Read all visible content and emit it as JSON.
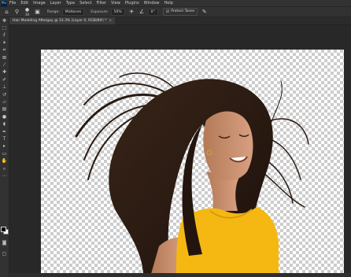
{
  "menubar": {
    "logo": "Ps",
    "items": [
      "File",
      "Edit",
      "Image",
      "Layer",
      "Type",
      "Select",
      "Filter",
      "View",
      "Plugins",
      "Window",
      "Help"
    ]
  },
  "options": {
    "home_icon": "home-icon",
    "brush_size": "30",
    "range_label": "Range:",
    "range_value": "Midtones",
    "exposure_label": "Exposure:",
    "exposure_value": "50%",
    "airbrush_value": "0°",
    "protect_tones_label": "Protect Tones"
  },
  "document": {
    "tab_title": "Hair Modeling Aftergay @ 33.3% (Layer 0, RGB/8#) *",
    "close": "×"
  },
  "tools": [
    "move",
    "marquee",
    "lasso",
    "magic-wand",
    "crop",
    "frame",
    "eyedropper",
    "healing",
    "brush",
    "clone-stamp",
    "history-brush",
    "eraser",
    "gradient",
    "blur",
    "dodge",
    "pen",
    "type",
    "path-select",
    "rectangle",
    "hand",
    "zoom",
    "more"
  ],
  "colors": {
    "foreground": "#000000",
    "background": "#ffffff",
    "shirt": "#f5b813",
    "hair": "#2a1a12",
    "skin": "#c68d6c"
  }
}
